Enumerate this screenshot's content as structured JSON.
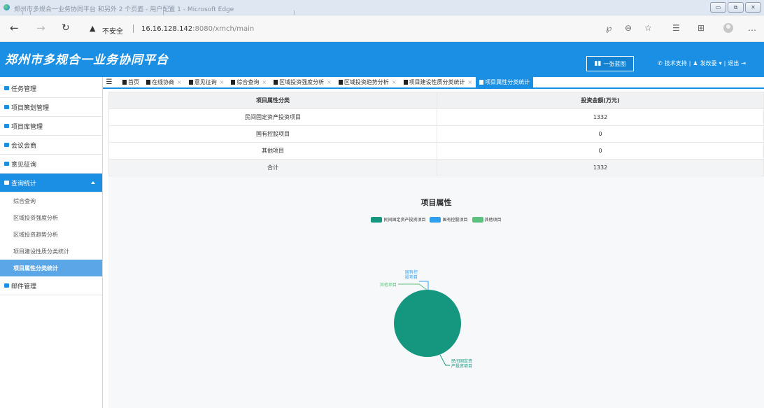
{
  "browser": {
    "window_title": "郑州市多规合一业务协同平台 和另外 2 个页面 - 用户配置 1 - Microsoft Edge",
    "not_secure": "不安全",
    "url_host": "16.16.128.142",
    "url_rest": ":8080/xmch/main"
  },
  "header": {
    "logo": "郑州市多规合一业务协同平台",
    "map_button": "一张蓝图",
    "support": "技术支持",
    "user": "发改委",
    "logout": "退出"
  },
  "sidebar": {
    "items": [
      {
        "label": "任务管理"
      },
      {
        "label": "项目策划管理"
      },
      {
        "label": "项目库管理"
      },
      {
        "label": "会议会商"
      },
      {
        "label": "意见征询"
      },
      {
        "label": "查询统计"
      }
    ],
    "sub_items": [
      {
        "label": "综合查询"
      },
      {
        "label": "区域投资强度分析"
      },
      {
        "label": "区域投资趋势分析"
      },
      {
        "label": "项目建设性质分类统计"
      },
      {
        "label": "项目属性分类统计"
      }
    ],
    "last_item": {
      "label": "邮件管理"
    }
  },
  "tabs": [
    {
      "label": "首页"
    },
    {
      "label": "在线协商"
    },
    {
      "label": "意见征询"
    },
    {
      "label": "综合查询"
    },
    {
      "label": "区域投资强度分析"
    },
    {
      "label": "区域投资趋势分析"
    },
    {
      "label": "项目建设性质分类统计"
    },
    {
      "label": "项目属性分类统计"
    }
  ],
  "table": {
    "headers": [
      "项目属性分类",
      "投资金额(万元)"
    ],
    "rows": [
      [
        "民间固定资产投资项目",
        "1332"
      ],
      [
        "国有控股项目",
        "0"
      ],
      [
        "其他项目",
        "0"
      ],
      [
        "合计",
        "1332"
      ]
    ]
  },
  "colors": {
    "primary": "#1a8fe3",
    "series": [
      "#15967f",
      "#2f9ff0",
      "#5cc07e"
    ]
  },
  "chart_data": {
    "type": "pie",
    "title": "项目属性",
    "legend_position": "top",
    "categories": [
      "民间固定资产投资项目",
      "国有控股项目",
      "其他项目"
    ],
    "values": [
      1332,
      0,
      0
    ],
    "labels": [
      "民间固定资\n产投资项目",
      "国有控\n股项目",
      "其他项目"
    ]
  }
}
